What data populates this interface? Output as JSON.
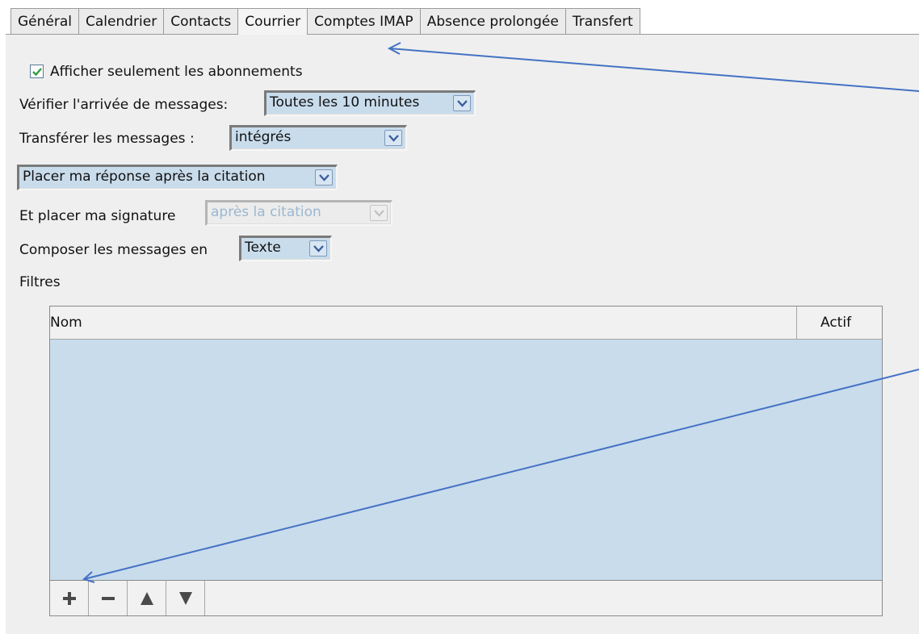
{
  "tabs": [
    "Général",
    "Calendrier",
    "Contacts",
    "Courrier",
    "Comptes IMAP",
    "Absence prolongée",
    "Transfert"
  ],
  "active_tab": "Courrier",
  "subscriptions": {
    "label": "Afficher seulement les abonnements",
    "checked": true
  },
  "check_mail": {
    "label": "Vérifier l'arrivée de messages:",
    "value": "Toutes les 10 minutes"
  },
  "forward": {
    "label": "Transférer les messages :",
    "value": "intégrés"
  },
  "reply_position": {
    "value": "Placer ma réponse après la citation"
  },
  "signature": {
    "label": "Et placer ma signature",
    "value": "après la citation",
    "disabled": true
  },
  "compose": {
    "label": "Composer les messages en",
    "value": "Texte"
  },
  "filters": {
    "label": "Filtres",
    "columns": [
      "Nom",
      "Actif"
    ],
    "rows": [],
    "toolbar": [
      "add-icon",
      "remove-icon",
      "move-up-icon",
      "move-down-icon"
    ]
  },
  "colors": {
    "selection_bg": "#c9dcec",
    "annotation": "#4472c4",
    "check": "#2e9c3c"
  }
}
